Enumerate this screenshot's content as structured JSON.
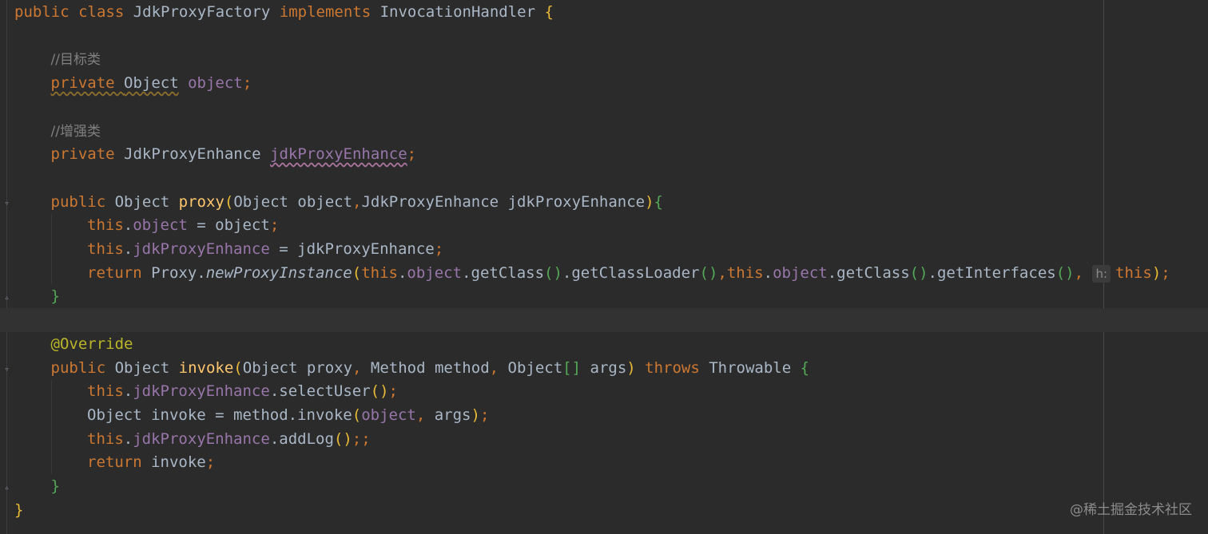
{
  "editor": {
    "watermark": "@稀土掘金技术社区",
    "lines": [
      {
        "tokens": [
          [
            "kw",
            "public "
          ],
          [
            "kw",
            "class "
          ],
          [
            "",
            "JdkProxyFactory "
          ],
          [
            "kw",
            "implements "
          ],
          [
            "",
            "InvocationHandler "
          ],
          [
            "p1",
            "{"
          ]
        ]
      },
      {
        "tokens": []
      },
      {
        "tokens": [
          [
            "cmt",
            "//目标类"
          ]
        ]
      },
      {
        "tokens": [
          [
            "kw sq",
            "private "
          ],
          [
            "sq",
            "Object"
          ],
          [
            "",
            ""
          ],
          [
            "fld",
            " object"
          ],
          [
            "kw",
            ";"
          ]
        ]
      },
      {
        "tokens": []
      },
      {
        "tokens": [
          [
            "cmt",
            "//增强类"
          ]
        ]
      },
      {
        "tokens": [
          [
            "kw",
            "private "
          ],
          [
            "",
            "JdkProxyEnhance "
          ],
          [
            "fld sqp",
            "jdkProxyEnhance"
          ],
          [
            "kw",
            ";"
          ]
        ]
      },
      {
        "tokens": []
      },
      {
        "tokens": [
          [
            "kw",
            "public "
          ],
          [
            "",
            "Object "
          ],
          [
            "fn",
            "proxy"
          ],
          [
            "p1",
            "("
          ],
          [
            "",
            "Object object"
          ],
          [
            "kw",
            ","
          ],
          [
            "",
            "JdkProxyEnhance jdkProxyEnhance"
          ],
          [
            "p1",
            ")"
          ],
          [
            "p2",
            "{"
          ]
        ]
      },
      {
        "tokens": [
          [
            "kw",
            "this"
          ],
          [
            "",
            "."
          ],
          [
            "fld",
            "object"
          ],
          [
            "",
            " = object"
          ],
          [
            "kw",
            ";"
          ]
        ]
      },
      {
        "tokens": [
          [
            "kw",
            "this"
          ],
          [
            "",
            "."
          ],
          [
            "fld",
            "jdkProxyEnhance"
          ],
          [
            "",
            " = jdkProxyEnhance"
          ],
          [
            "kw",
            ";"
          ]
        ]
      },
      {
        "tokens": [
          [
            "kw",
            "return "
          ],
          [
            "",
            "Proxy."
          ],
          [
            "it",
            "newProxyInstance"
          ],
          [
            "p1",
            "("
          ],
          [
            "kw",
            "this"
          ],
          [
            "",
            "."
          ],
          [
            "fld",
            "object"
          ],
          [
            "",
            ".getClass"
          ],
          [
            "p2",
            "()"
          ],
          [
            "",
            ".getClassLoader"
          ],
          [
            "p2",
            "()"
          ],
          [
            "kw",
            ","
          ],
          [
            "kw",
            "this"
          ],
          [
            "",
            "."
          ],
          [
            "fld",
            "object"
          ],
          [
            "",
            ".getClass"
          ],
          [
            "p2",
            "()"
          ],
          [
            "",
            ".getInterfaces"
          ],
          [
            "p2",
            "()"
          ],
          [
            "kw",
            ", "
          ],
          [
            "hint",
            "h:"
          ],
          [
            "kw",
            "this"
          ],
          [
            "p1",
            ")"
          ],
          [
            "kw",
            ";"
          ]
        ]
      },
      {
        "tokens": [
          [
            "p2",
            "}"
          ]
        ]
      },
      {
        "tokens": []
      },
      {
        "tokens": [
          [
            "ann",
            "@Override"
          ]
        ]
      },
      {
        "tokens": [
          [
            "kw",
            "public "
          ],
          [
            "",
            "Object "
          ],
          [
            "fn",
            "invoke"
          ],
          [
            "p1",
            "("
          ],
          [
            "",
            "Object proxy"
          ],
          [
            "kw",
            ", "
          ],
          [
            "",
            "Method method"
          ],
          [
            "kw",
            ", "
          ],
          [
            "",
            "Object"
          ],
          [
            "p2",
            "[]"
          ],
          [
            "",
            " args"
          ],
          [
            "p1",
            ")"
          ],
          [
            "kw",
            " throws "
          ],
          [
            "",
            "Throwable "
          ],
          [
            "p2",
            "{"
          ]
        ]
      },
      {
        "tokens": [
          [
            "kw",
            "this"
          ],
          [
            "",
            "."
          ],
          [
            "fld",
            "jdkProxyEnhance"
          ],
          [
            "",
            ".selectUser"
          ],
          [
            "p1",
            "()"
          ],
          [
            "kw",
            ";"
          ]
        ]
      },
      {
        "tokens": [
          [
            "",
            "Object invoke = method.invoke"
          ],
          [
            "p1",
            "("
          ],
          [
            "fld",
            "object"
          ],
          [
            "kw",
            ", "
          ],
          [
            "",
            "args"
          ],
          [
            "p1",
            ")"
          ],
          [
            "kw",
            ";"
          ]
        ]
      },
      {
        "tokens": [
          [
            "kw",
            "this"
          ],
          [
            "",
            "."
          ],
          [
            "fld",
            "jdkProxyEnhance"
          ],
          [
            "",
            ".addLog"
          ],
          [
            "p1",
            "()"
          ],
          [
            "kw",
            ";;"
          ]
        ]
      },
      {
        "tokens": [
          [
            "kw",
            "return "
          ],
          [
            "",
            "invoke"
          ],
          [
            "kw",
            ";"
          ]
        ]
      },
      {
        "tokens": [
          [
            "p2",
            "}"
          ]
        ]
      },
      {
        "tokens": [
          [
            "p1",
            "}"
          ]
        ]
      }
    ]
  }
}
